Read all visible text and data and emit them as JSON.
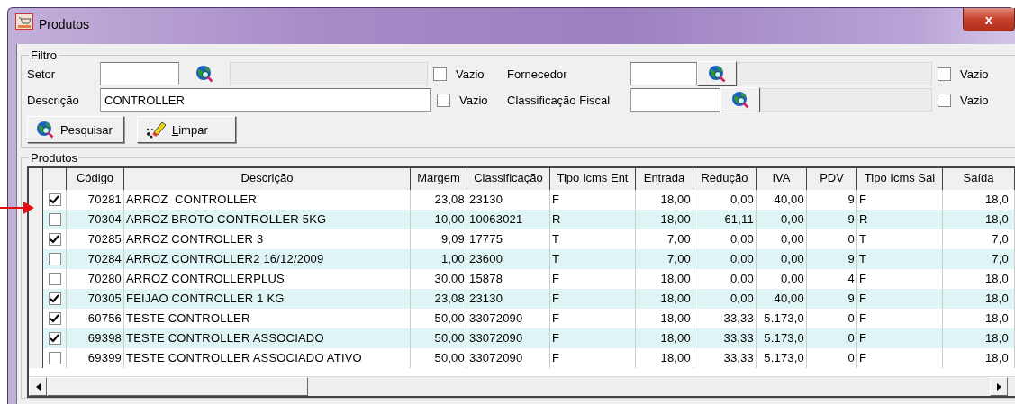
{
  "window": {
    "title": "Produtos",
    "close": "x"
  },
  "filter": {
    "title": "Filtro",
    "left": [
      {
        "label": "Setor",
        "kind": "lookup",
        "vazio": {
          "label": "Vazio",
          "checked": false
        }
      },
      {
        "label": "Descrição",
        "value": "CONTROLLER",
        "kind": "text",
        "vazio": {
          "label": "Vazio",
          "checked": false
        }
      }
    ],
    "right": [
      {
        "label": "Fornecedor",
        "kind": "lookup-button",
        "vazio": {
          "label": "Vazio",
          "checked": false
        }
      },
      {
        "label": "Classificação Fiscal",
        "kind": "lookup-button",
        "vazio": {
          "label": "Vazio",
          "checked": false
        }
      }
    ],
    "buttons": [
      {
        "label": "Pesquisar",
        "kind": "search",
        "mnemonic": false
      },
      {
        "label": "Limpar",
        "kind": "clear",
        "mnemonic": true
      }
    ]
  },
  "products": {
    "title": "Produtos",
    "columns": [
      {
        "label": "Código",
        "kind": "number"
      },
      {
        "label": "Descrição",
        "kind": "text"
      },
      {
        "label": "Margem",
        "kind": "number"
      },
      {
        "label": "Classificação",
        "kind": "text"
      },
      {
        "label": "Tipo Icms Ent",
        "kind": "text"
      },
      {
        "label": "Entrada",
        "kind": "number"
      },
      {
        "label": "Redução",
        "kind": "number"
      },
      {
        "label": "IVA",
        "kind": "number"
      },
      {
        "label": "PDV",
        "kind": "number"
      },
      {
        "label": "Tipo Icms Sai",
        "kind": "text"
      },
      {
        "label": "Saída",
        "kind": "number"
      }
    ],
    "rows": [
      {
        "checked": true,
        "cells": [
          "70281",
          "ARROZ  CONTROLLER",
          "23,08",
          "23130",
          "F",
          "18,00",
          "0,00",
          "40,00",
          "9",
          "F",
          "18,0"
        ]
      },
      {
        "checked": false,
        "cells": [
          "70304",
          "ARROZ BROTO CONTROLLER 5KG",
          "10,00",
          "10063021",
          "R",
          "18,00",
          "61,11",
          "0,00",
          "9",
          "R",
          "18,0"
        ]
      },
      {
        "checked": true,
        "cells": [
          "70285",
          "ARROZ CONTROLLER 3",
          "9,09",
          "17775",
          "T",
          "7,00",
          "0,00",
          "0,00",
          "0",
          "T",
          "7,0"
        ]
      },
      {
        "checked": false,
        "cells": [
          "70284",
          "ARROZ CONTROLLER2 16/12/2009",
          "1,00",
          "23600",
          "T",
          "7,00",
          "0,00",
          "0,00",
          "9",
          "T",
          "7,0"
        ]
      },
      {
        "checked": false,
        "cells": [
          "70280",
          "ARROZ CONTROLLERPLUS",
          "30,00",
          "15878",
          "F",
          "18,00",
          "0,00",
          "0,00",
          "4",
          "F",
          "18,0"
        ]
      },
      {
        "checked": true,
        "cells": [
          "70305",
          "FEIJAO CONTROLLER 1 KG",
          "23,08",
          "23130",
          "F",
          "18,00",
          "0,00",
          "40,00",
          "9",
          "F",
          "18,0"
        ]
      },
      {
        "checked": true,
        "cells": [
          "60756",
          "TESTE CONTROLLER",
          "50,00",
          "33072090",
          "F",
          "18,00",
          "33,33",
          "5.173,0",
          "0",
          "F",
          "18,0"
        ]
      },
      {
        "checked": true,
        "cells": [
          "69398",
          "TESTE CONTROLLER ASSOCIADO",
          "50,00",
          "33072090",
          "F",
          "18,00",
          "33,33",
          "5.173,0",
          "0",
          "F",
          "18,0"
        ]
      },
      {
        "checked": false,
        "cells": [
          "69399",
          "TESTE CONTROLLER ASSOCIADO ATIVO",
          "50,00",
          "33072090",
          "F",
          "18,00",
          "33,33",
          "5.173,0",
          "0",
          "F",
          "18,0"
        ]
      }
    ]
  }
}
